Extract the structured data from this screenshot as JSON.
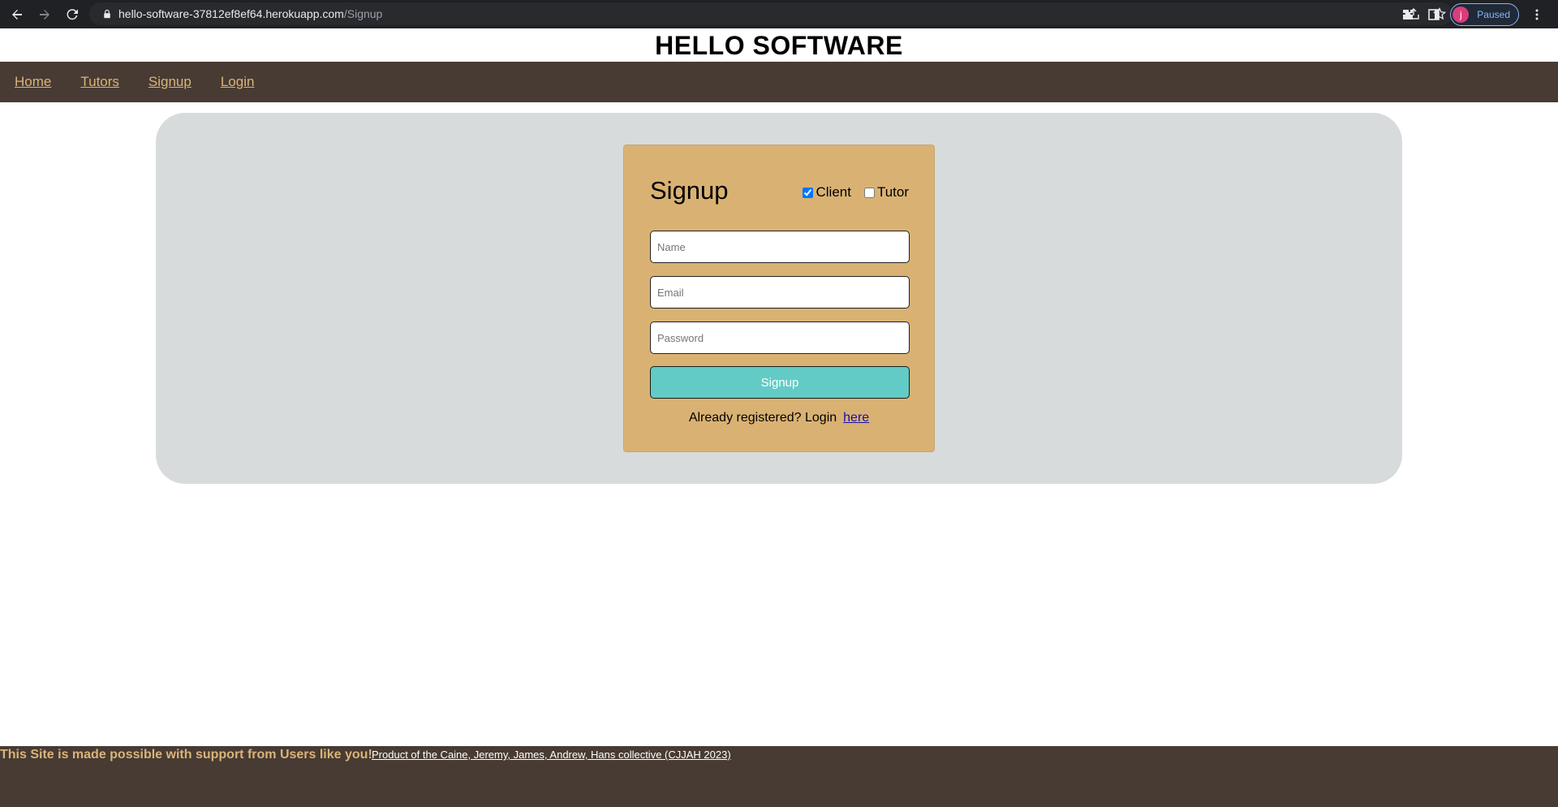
{
  "browser": {
    "url_host": "hello-software-37812ef8ef64.herokuapp.com",
    "url_path": "/Signup",
    "profile_initial": "j",
    "profile_status": "Paused"
  },
  "site": {
    "title": "HELLO SOFTWARE"
  },
  "nav": {
    "items": [
      {
        "label": "Home"
      },
      {
        "label": "Tutors"
      },
      {
        "label": "Signup"
      },
      {
        "label": "Login"
      }
    ]
  },
  "signup_form": {
    "title": "Signup",
    "roles": [
      {
        "label": "Client",
        "checked": true
      },
      {
        "label": "Tutor",
        "checked": false
      }
    ],
    "name_placeholder": "Name",
    "email_placeholder": "Email",
    "password_placeholder": "Password",
    "submit_label": "Signup",
    "login_prompt": "Already registered? Login",
    "login_link": "here"
  },
  "footer": {
    "support_text": "This Site is made possible with support from Users like you!",
    "credit_text": "Product of the Caine, Jeremy, James, Andrew, Hans collective (CJJAH 2023)"
  },
  "colors": {
    "nav_bg": "#483b33",
    "nav_link": "#d9b47a",
    "panel_bg": "#d7dbdc",
    "card_bg": "#d9b273",
    "button_bg": "#63cbc5"
  }
}
